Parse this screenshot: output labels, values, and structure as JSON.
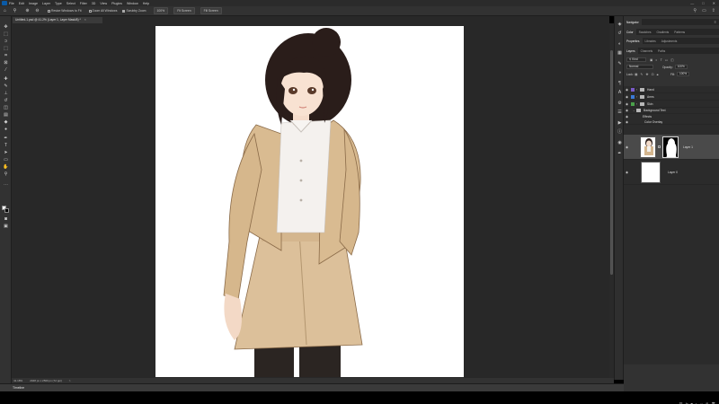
{
  "menubar": {
    "items": [
      "File",
      "Edit",
      "Image",
      "Layer",
      "Type",
      "Select",
      "Filter",
      "3D",
      "View",
      "Plugins",
      "Window",
      "Help"
    ]
  },
  "options": {
    "resize_windows": "Resize Windows to Fit",
    "zoom_all_windows": "Zoom All Windows",
    "scrubby_zoom": "Scrubby Zoom",
    "zoom_100": "100%",
    "fit_screen": "Fit Screen",
    "fill_screen": "Fill Screen"
  },
  "document_tab": {
    "title": "Untitled-1.psd @ 41.2% (Layer 1, Layer Mask/8) *",
    "close": "×"
  },
  "status": {
    "zoom": "41.18%",
    "doc_size": "2048 px x 2560 px (72 ppi)",
    "arrow": ">"
  },
  "timeline": {
    "label": "Timeline"
  },
  "panels": {
    "top_tabs": [
      "Navigator"
    ],
    "swatch_tabs": [
      "Color",
      "Swatches",
      "Gradients",
      "Patterns"
    ],
    "props_tabs": [
      "Properties",
      "Libraries",
      "Adjustments"
    ],
    "layers_tabs": [
      "Layers",
      "Channels",
      "Paths"
    ],
    "kind_label": "Kind",
    "blend_mode": "Normal",
    "opacity_label": "Opacity:",
    "opacity_value": "100%",
    "lock_label": "Lock:",
    "fill_label": "Fill:",
    "fill_value": "100%"
  },
  "layers": [
    {
      "name": "Hand",
      "type": "group",
      "color": "#7a5ac8"
    },
    {
      "name": "Arms",
      "type": "group",
      "color": "#3a7ad8"
    },
    {
      "name": "Skin",
      "type": "group",
      "color": "#4aa04a"
    },
    {
      "name": "Background Text",
      "type": "group-open",
      "color": ""
    },
    {
      "name": "Effects",
      "type": "effects",
      "color": ""
    },
    {
      "name": "Color Overlay",
      "type": "effect",
      "color": ""
    },
    {
      "name": "Layer 1",
      "type": "masked-layer",
      "color": ""
    },
    {
      "name": "Layer 0",
      "type": "layer",
      "color": ""
    }
  ],
  "icons": {
    "eye": "eye-icon",
    "folder": "folder-icon",
    "lock": "lock-icon"
  },
  "colors": {
    "artboard": "#ffffff",
    "canvas_bg": "#282828",
    "panel_bg": "#323232",
    "selected_layer": "#4a4a4a"
  }
}
